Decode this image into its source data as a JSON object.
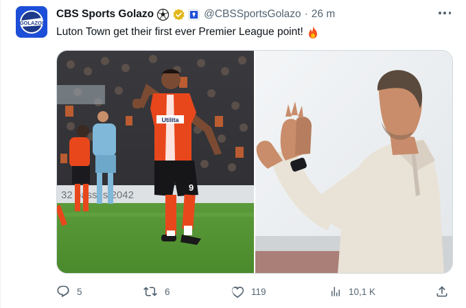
{
  "account": {
    "name": "CBS Sports Golazo",
    "handle": "@CBSSportsGolazo",
    "separator": "·",
    "time": "26 m",
    "avatar_text": "GOLAZO!"
  },
  "tweet": {
    "text": "Luton Town get their first ever Premier League point!",
    "emoji": "fire-emoji"
  },
  "media": {
    "left_photo": {
      "shirt_sponsor": "Utilita",
      "shirt_number": "9",
      "board_text": "32 passes 2042"
    },
    "right_photo": {}
  },
  "actions": {
    "replies": "5",
    "retweets": "6",
    "likes": "119",
    "views": "10,1 K"
  },
  "colors": {
    "verified_gold": "#e2b719",
    "text_secondary": "#536471",
    "luton_orange": "#e8471c"
  },
  "icons": [
    "soccer-ball-icon",
    "verified-badge-icon",
    "affiliate-badge-icon",
    "more-icon",
    "reply-icon",
    "retweet-icon",
    "like-icon",
    "views-icon",
    "share-icon"
  ]
}
